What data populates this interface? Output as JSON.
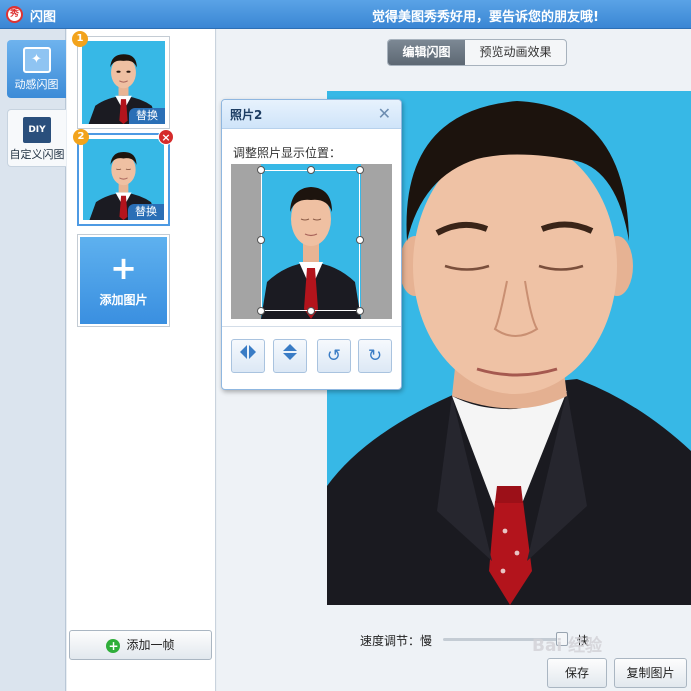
{
  "window": {
    "app_icon": "秀",
    "title": "闪图",
    "slogan": "觉得美图秀秀好用，要告诉您的朋友哦!"
  },
  "modes": [
    {
      "label": "动感闪图",
      "icon": "sparkle-icon",
      "active": true
    },
    {
      "label": "自定义闪图",
      "icon_text": "DIY",
      "icon": "diy-icon",
      "active": false
    }
  ],
  "frames": {
    "items": [
      {
        "number": "1",
        "replace_label": "替换",
        "selected": false
      },
      {
        "number": "2",
        "replace_label": "替换",
        "selected": true,
        "delete_symbol": "×"
      }
    ],
    "add_image_label": "添加图片",
    "add_image_symbol": "+",
    "add_frame_label": "添加一帧"
  },
  "main": {
    "tabs": [
      {
        "label": "编辑闪图",
        "active": true
      },
      {
        "label": "预览动画效果",
        "active": false
      }
    ],
    "speed_label": "速度调节：慢",
    "speed_fast_label": "快",
    "save_label": "保存",
    "copy_label": "复制图片"
  },
  "dialog": {
    "title": "照片2",
    "close_symbol": "✕",
    "hint": "调整照片显示位置：",
    "tools": [
      {
        "name": "flip-horizontal-icon",
        "glyph": "◀▶"
      },
      {
        "name": "flip-vertical-icon",
        "glyph": "⬍"
      },
      {
        "name": "rotate-left-icon",
        "glyph": "↺"
      },
      {
        "name": "rotate-right-icon",
        "glyph": "↻"
      }
    ]
  },
  "watermark": "Bai 经验",
  "colors": {
    "title_bar": "#3a86d4",
    "photo_background": "#37b8e6",
    "accent": "#4d9ae3",
    "badge_orange": "#f2a31c",
    "delete_red": "#d52b2b"
  }
}
